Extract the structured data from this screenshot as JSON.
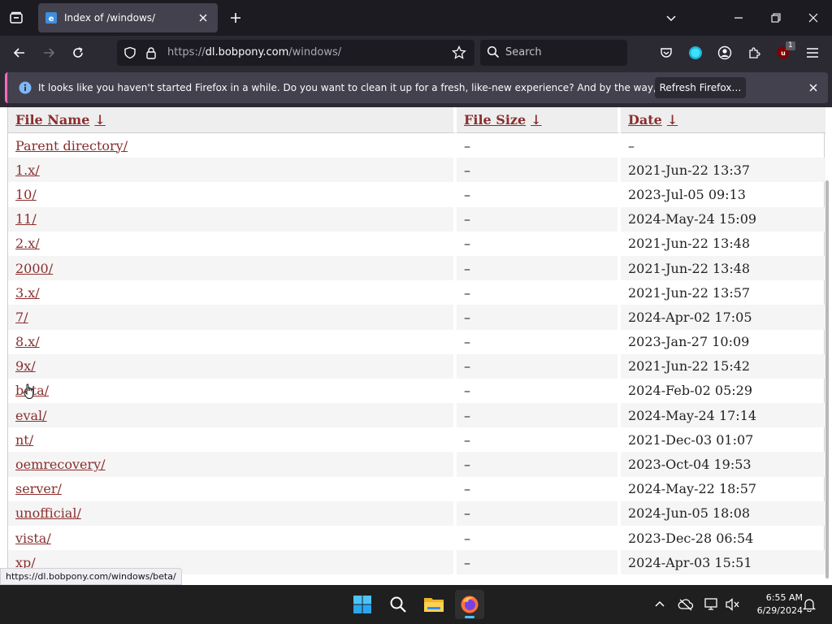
{
  "browser": {
    "tab": {
      "title": "Index of /windows/"
    },
    "url": {
      "prefix": "https://",
      "host": "dl.bobpony.com",
      "path": "/windows/"
    },
    "search": {
      "placeholder": "Search"
    },
    "extension_badge": "1",
    "accent": "#ff6bba"
  },
  "notification": {
    "message": "It looks like you haven't started Firefox in a while. Do you want to clean it up for a fresh, like-new experience? And by the way, welcome back!",
    "button_label": "Refresh Firefox…"
  },
  "listing": {
    "headers": {
      "name": "File Name",
      "size": "File Size",
      "date": "Date",
      "sort_arrow": "↓"
    },
    "rows": [
      {
        "name": "Parent directory/",
        "size": "–",
        "date": "–"
      },
      {
        "name": "1.x/",
        "size": "–",
        "date": "2021-Jun-22 13:37"
      },
      {
        "name": "10/",
        "size": "–",
        "date": "2023-Jul-05 09:13"
      },
      {
        "name": "11/",
        "size": "–",
        "date": "2024-May-24 15:09"
      },
      {
        "name": "2.x/",
        "size": "–",
        "date": "2021-Jun-22 13:48"
      },
      {
        "name": "2000/",
        "size": "–",
        "date": "2021-Jun-22 13:48"
      },
      {
        "name": "3.x/",
        "size": "–",
        "date": "2021-Jun-22 13:57"
      },
      {
        "name": "7/",
        "size": "–",
        "date": "2024-Apr-02 17:05"
      },
      {
        "name": "8.x/",
        "size": "–",
        "date": "2023-Jan-27 10:09"
      },
      {
        "name": "9x/",
        "size": "–",
        "date": "2021-Jun-22 15:42"
      },
      {
        "name": "beta/",
        "size": "–",
        "date": "2024-Feb-02 05:29"
      },
      {
        "name": "eval/",
        "size": "–",
        "date": "2024-May-24 17:14"
      },
      {
        "name": "nt/",
        "size": "–",
        "date": "2021-Dec-03 01:07"
      },
      {
        "name": "oemrecovery/",
        "size": "–",
        "date": "2023-Oct-04 19:53"
      },
      {
        "name": "server/",
        "size": "–",
        "date": "2024-May-22 18:57"
      },
      {
        "name": "unofficial/",
        "size": "–",
        "date": "2024-Jun-05 18:08"
      },
      {
        "name": "vista/",
        "size": "–",
        "date": "2023-Dec-28 06:54"
      },
      {
        "name": "xp/",
        "size": "–",
        "date": "2024-Apr-03 15:51"
      }
    ]
  },
  "status_link": "https://dl.bobpony.com/windows/beta/",
  "taskbar": {
    "time": "6:55 AM",
    "date": "6/29/2024"
  }
}
